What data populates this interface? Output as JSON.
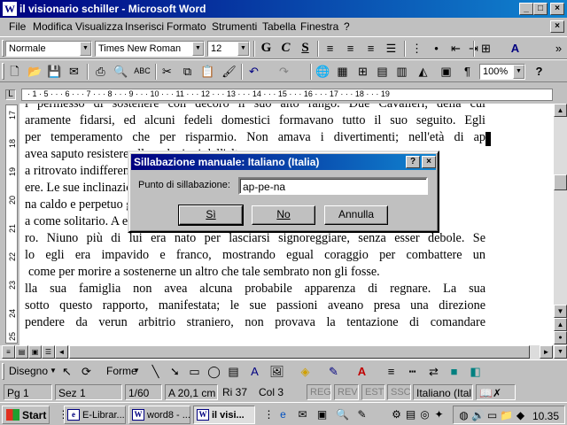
{
  "window": {
    "title": "il visionario schiller - Microsoft Word",
    "app_icon": "W",
    "minimize": "_",
    "maximize": "□",
    "close": "×"
  },
  "menu": {
    "items": [
      "File",
      "Modifica",
      "Visualizza",
      "Inserisci",
      "Formato",
      "Strumenti",
      "Tabella",
      "Finestra",
      "?"
    ],
    "doc_close": "×"
  },
  "formatting": {
    "style": "Normale",
    "font": "Times New Roman",
    "size": "12",
    "bold": "G",
    "italic": "C",
    "underline": "S"
  },
  "standard": {
    "zoom": "100%",
    "help": "?"
  },
  "ruler": {
    "marks": "· 1 · 5 · · · 6 · · · 7 · · · 8 · · · 9 · · · 10 · · · 11 · · · 12 · · · 13 · · · 14 · · · 15 · · · 16 · · · 17 · · · 18 · · · 19",
    "vertical_marks": [
      "17",
      "18",
      "19",
      "20",
      "21",
      "22",
      "23",
      "24",
      "25"
    ],
    "tab_marker": "L"
  },
  "document": {
    "lines": [
      "l permesso di sostenere con decoro il suo alto rango. Due Cavalieri, della cui",
      "aramente fidarsi, ed alcuni fedeli domestici formavano tutto il suo seguito. Egli",
      "per temperamento che per risparmio. Non amava i divertimenti; nell'età di ap",
      "avea saputo resistere alle seduzioni dell'altro sesso",
      "a ritrovato indifferente alla conia",
      "ere. Le sue inclinazioni enta e",
      "na caldo e perpetuo gran",
      "a come solitario. A  egli",
      "ro. Niuno più di lui era nato per lasciarsi signoreggiare, senza esser debole. Se",
      "lo egli era impavido e franco, mostrando egual coraggio per combattere un",
      "come per morire a sostenerne un altro che tale sembrato non gli fosse.",
      "lla sua famiglia non avea alcuna probabile apparenza di regnare. La sua",
      "sotto questo rapporto, manifestata; le sue passioni aveano presa una direzione",
      "pendere da verun arbitrio straniero, non provava la tentazione di comandare"
    ]
  },
  "dialog": {
    "title": "Sillabazione manuale: Italiano (Italia)",
    "help": "?",
    "close": "×",
    "label": "Punto di sillabazione:",
    "value": "ap-pe-na",
    "yes": "Sì",
    "no": "No",
    "cancel": "Annulla"
  },
  "drawing": {
    "draw_menu": "Disegno",
    "shapes_menu": "Forme"
  },
  "status": {
    "page": "Pg 1",
    "section": "Sez 1",
    "pages": "1/60",
    "at": "A 20,1 cm",
    "line": "Ri 37",
    "col": "Col 3",
    "rec": "REG",
    "rev": "REV",
    "ext": "EST",
    "ovr": "SSC",
    "language": "Italiano (Ital"
  },
  "taskbar": {
    "start": "Start",
    "tasks": [
      "E-Librar...",
      "word8 - ...",
      "il visi..."
    ],
    "clock": "10.35"
  }
}
